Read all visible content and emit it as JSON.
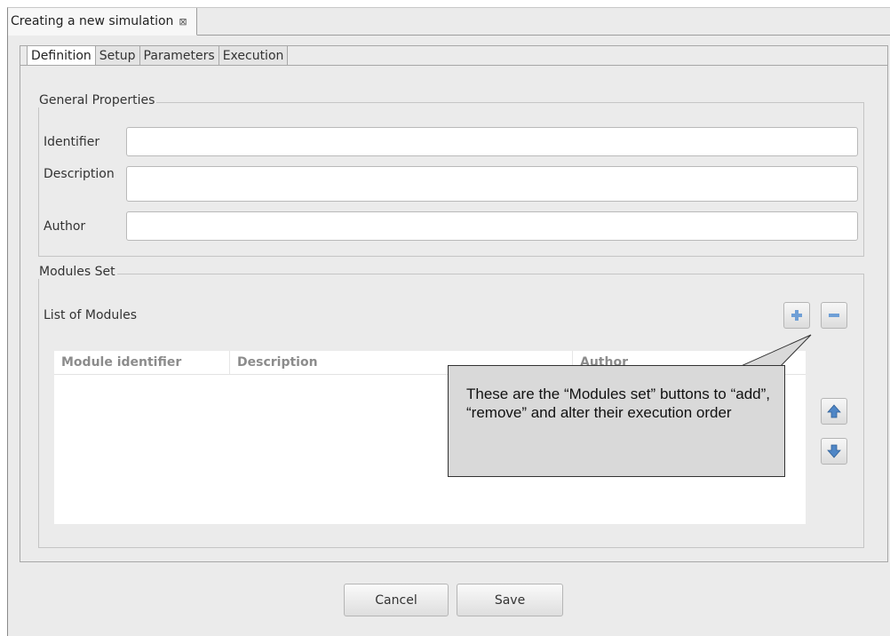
{
  "editor_tab": {
    "title": "Creating a new simulation",
    "close_glyph": "⊠"
  },
  "tabs": [
    {
      "label": "Definition",
      "active": true
    },
    {
      "label": "Setup",
      "active": false
    },
    {
      "label": "Parameters",
      "active": false
    },
    {
      "label": "Execution",
      "active": false
    }
  ],
  "general_properties": {
    "title": "General Properties",
    "identifier_label": "Identifier",
    "identifier_value": "",
    "description_label": "Description",
    "description_value": "",
    "author_label": "Author",
    "author_value": ""
  },
  "modules_set": {
    "title": "Modules Set",
    "list_label": "List of Modules",
    "columns": [
      "Module identifier",
      "Description",
      "Author"
    ],
    "rows": [],
    "icons": {
      "add": "plus-icon",
      "remove": "minus-icon",
      "up": "arrow-up-icon",
      "down": "arrow-down-icon"
    }
  },
  "callout": {
    "text": "These are the “Modules set” buttons to “add”, “remove” and alter their execution order"
  },
  "footer": {
    "cancel_label": "Cancel",
    "save_label": "Save"
  },
  "colors": {
    "window_bg": "#ebebeb",
    "accent_icon": "#5b8fc8",
    "callout_bg": "#d9d9d9"
  }
}
